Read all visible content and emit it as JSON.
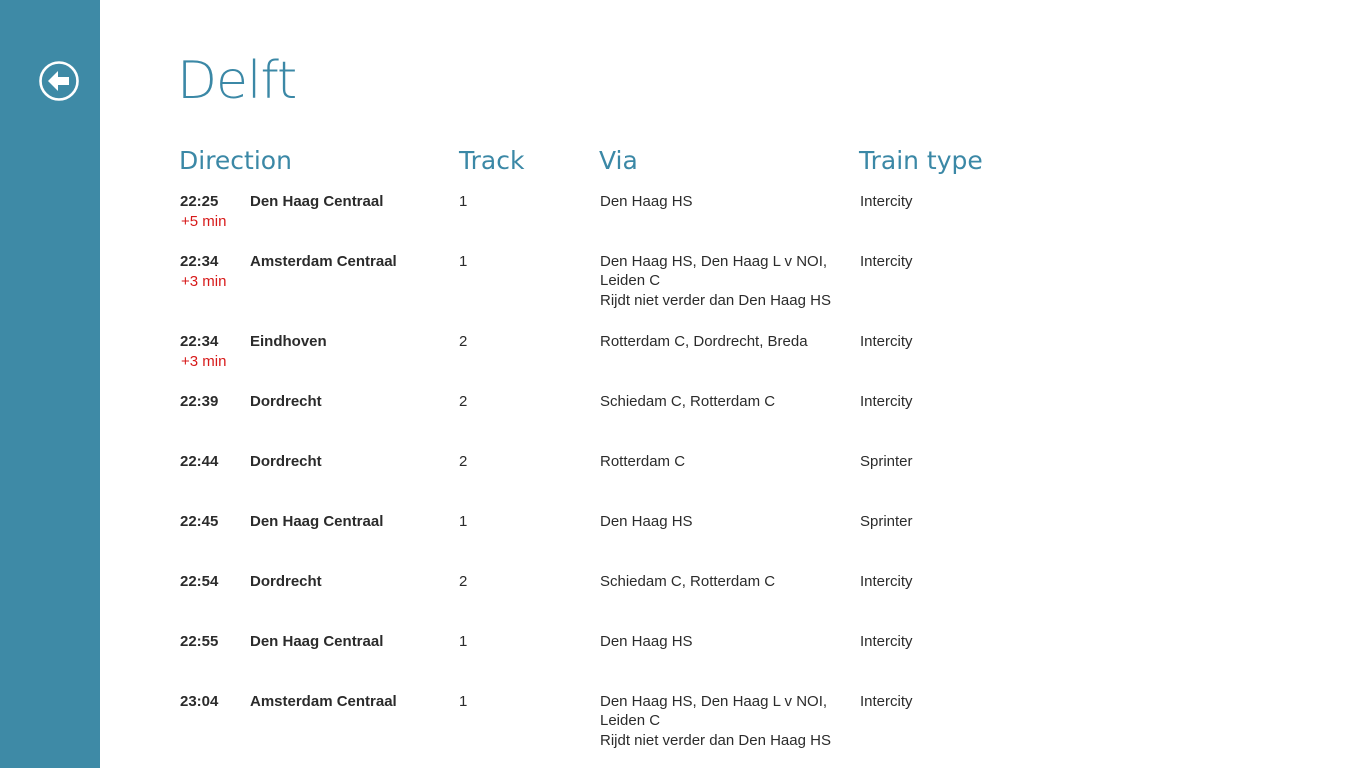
{
  "page": {
    "title": "Delft",
    "back_label": "Back"
  },
  "headers": {
    "direction": "Direction",
    "track": "Track",
    "via": "Via",
    "train_type": "Train type"
  },
  "colors": {
    "accent": "#3b88a6",
    "sidebar": "#3e8aa6",
    "delay": "#d71a1a"
  },
  "departures": [
    {
      "time": "22:25",
      "delay": "+5 min",
      "destination": "Den Haag Centraal",
      "track": "1",
      "via": "Den Haag HS",
      "note": "",
      "type": "Intercity"
    },
    {
      "time": "22:34",
      "delay": "+3 min",
      "destination": "Amsterdam Centraal",
      "track": "1",
      "via": "Den Haag HS, Den Haag L v NOI, Leiden C",
      "note": "Rijdt niet verder dan  Den Haag HS",
      "type": "Intercity"
    },
    {
      "time": "22:34",
      "delay": "+3 min",
      "destination": "Eindhoven",
      "track": "2",
      "via": "Rotterdam C, Dordrecht, Breda",
      "note": "",
      "type": "Intercity"
    },
    {
      "time": "22:39",
      "delay": "",
      "destination": "Dordrecht",
      "track": "2",
      "via": "Schiedam C, Rotterdam C",
      "note": "",
      "type": "Intercity"
    },
    {
      "time": "22:44",
      "delay": "",
      "destination": "Dordrecht",
      "track": "2",
      "via": "Rotterdam C",
      "note": "",
      "type": "Sprinter"
    },
    {
      "time": "22:45",
      "delay": "",
      "destination": "Den Haag Centraal",
      "track": "1",
      "via": "Den Haag HS",
      "note": "",
      "type": "Sprinter"
    },
    {
      "time": "22:54",
      "delay": "",
      "destination": "Dordrecht",
      "track": "2",
      "via": "Schiedam C, Rotterdam C",
      "note": "",
      "type": "Intercity"
    },
    {
      "time": "22:55",
      "delay": "",
      "destination": "Den Haag Centraal",
      "track": "1",
      "via": "Den Haag HS",
      "note": "",
      "type": "Intercity"
    },
    {
      "time": "23:04",
      "delay": "",
      "destination": "Amsterdam Centraal",
      "track": "1",
      "via": "Den Haag HS, Den Haag L v NOI, Leiden C",
      "note": "Rijdt niet verder dan  Den Haag HS",
      "type": "Intercity"
    }
  ]
}
